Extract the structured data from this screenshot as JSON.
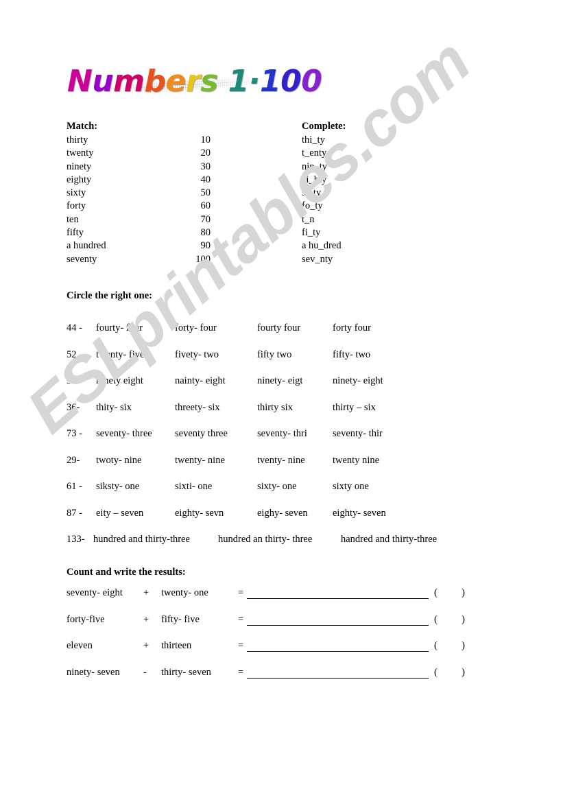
{
  "title": {
    "text": "Numbers 1-100",
    "letters": [
      {
        "ch": "N",
        "color": "#cc0099"
      },
      {
        "ch": "u",
        "color": "#9900cc"
      },
      {
        "ch": "m",
        "color": "#cc0066"
      },
      {
        "ch": "b",
        "color": "#e8521e"
      },
      {
        "ch": "e",
        "color": "#f08c1a"
      },
      {
        "ch": "r",
        "color": "#e8c41e"
      },
      {
        "ch": "s",
        "color": "#77bb33"
      },
      {
        "ch": " ",
        "color": "#ffffff"
      },
      {
        "ch": "1",
        "color": "#1b8a7a"
      },
      {
        "ch": "·",
        "color": "#1b8a7a"
      },
      {
        "ch": "1",
        "color": "#2233cc"
      },
      {
        "ch": "0",
        "color": "#3322cc"
      },
      {
        "ch": "0",
        "color": "#8822cc"
      }
    ]
  },
  "watermark": {
    "text": "ESLprintables.com",
    "color": "#d6d6d6"
  },
  "match": {
    "heading": "Match:",
    "words": [
      "thirty",
      "twenty",
      "ninety",
      "eighty",
      "sixty",
      "forty",
      "ten",
      "fifty",
      "a hundred",
      "seventy"
    ],
    "numbers": [
      "10",
      "20",
      "30",
      "40",
      "50",
      "60",
      "70",
      "80",
      "90",
      "100"
    ]
  },
  "complete": {
    "heading": "Complete:",
    "items": [
      "thi_ty",
      "t_enty",
      "nin_ty",
      "ei_hty",
      "si_ty",
      "fo_ty",
      "t_n",
      "fi_ty",
      "a hu_dred",
      "sev_nty"
    ]
  },
  "circle": {
    "heading": "Circle the right one:",
    "rows": [
      {
        "number": "44 -",
        "options": [
          "fourty- four",
          "forty- four",
          "fourty four",
          "forty four"
        ]
      },
      {
        "number": "52 -",
        "options": [
          "twenty- five",
          "fivety- two",
          "fifty two",
          "fifty- two"
        ]
      },
      {
        "number": "98-",
        "options": [
          "ninety eight",
          "nainty- eight",
          "ninety- eigt",
          "ninety- eight"
        ]
      },
      {
        "number": "36-",
        "options": [
          "thity- six",
          "threety- six",
          "thirty six",
          "thirty – six"
        ]
      },
      {
        "number": "73 -",
        "options": [
          "seventy- three",
          "seventy three",
          "seventy- thri",
          "seventy- thir"
        ]
      },
      {
        "number": "29-",
        "options": [
          "twoty- nine",
          "twenty- nine",
          "tventy- nine",
          "twenty nine"
        ]
      },
      {
        "number": "61 -",
        "options": [
          "siksty- one",
          "sixti- one",
          "sixty- one",
          "sixty one"
        ]
      },
      {
        "number": "87 -",
        "options": [
          "eity – seven",
          "eighty- sevn",
          "eighy- seven",
          "eighty- seven"
        ]
      },
      {
        "number": "133-",
        "options": [
          "hundred and thirty-three",
          "hundred an thirty- three",
          "handred and thirty-three"
        ],
        "wide": true
      }
    ]
  },
  "count": {
    "heading": "Count and write the results:",
    "equals": "=",
    "paren_left": "(",
    "paren_right": ")",
    "rows": [
      {
        "a": "seventy- eight",
        "op": "+",
        "b": "twenty- one"
      },
      {
        "a": "forty-five",
        "op": "+",
        "b": "fifty- five"
      },
      {
        "a": "eleven",
        "op": "+",
        "b": "thirteen"
      },
      {
        "a": "ninety- seven",
        "op": "-",
        "b": "thirty- seven"
      }
    ]
  }
}
